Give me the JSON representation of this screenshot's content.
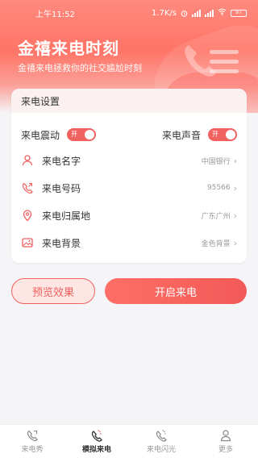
{
  "status_bar": {
    "time": "上午11:52",
    "network_speed": "1.7K/s",
    "battery": "97"
  },
  "hero": {
    "title": "金禧来电时刻",
    "subtitle": "金禧来电拯救你的社交尴尬时刻"
  },
  "settings": {
    "header": "来电设置",
    "vibrate_label": "来电震动",
    "vibrate_switch_text": "开",
    "sound_label": "来电声音",
    "sound_switch_text": "开",
    "rows": [
      {
        "label": "来电名字",
        "value": "中国银行",
        "icon": "person-icon"
      },
      {
        "label": "来电号码",
        "value": "95566",
        "icon": "phone-icon"
      },
      {
        "label": "来电归属地",
        "value": "广东广州",
        "icon": "location-pin-icon"
      },
      {
        "label": "来电背景",
        "value": "金色背景",
        "icon": "image-icon"
      }
    ]
  },
  "actions": {
    "preview_label": "预览效果",
    "start_label": "开启来电"
  },
  "tabbar": {
    "items": [
      {
        "label": "来电秀",
        "icon": "call-show-icon",
        "active": false
      },
      {
        "label": "模拟来电",
        "icon": "simulated-call-icon",
        "active": true
      },
      {
        "label": "来电闪光",
        "icon": "flash-icon",
        "active": false
      },
      {
        "label": "更多",
        "icon": "profile-icon",
        "active": false
      }
    ]
  },
  "colors": {
    "accent": "#f06260",
    "hero_gradient_top": "#ff8a7e",
    "card_header_bg": "#fbf1f0"
  }
}
